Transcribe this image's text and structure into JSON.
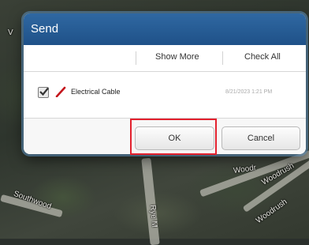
{
  "dialog": {
    "title": "Send",
    "toolbar": {
      "show_more_label": "Show More",
      "check_all_label": "Check All"
    },
    "items": [
      {
        "checked": true,
        "icon": "pencil-icon",
        "icon_color": "#c4151c",
        "label": "Electrical Cable",
        "date": "8/21/2023 1:21 PM"
      }
    ],
    "buttons": {
      "ok_label": "OK",
      "cancel_label": "Cancel"
    },
    "accent_color": "#2a5f99",
    "highlight_color": "#e3212e"
  },
  "map": {
    "labels": {
      "southwood": "Southwood",
      "rye": "Rye M",
      "woodr": "Woodr",
      "woodrush": "Woodrush",
      "woodrush2": "Woodrush",
      "v": "V"
    }
  }
}
